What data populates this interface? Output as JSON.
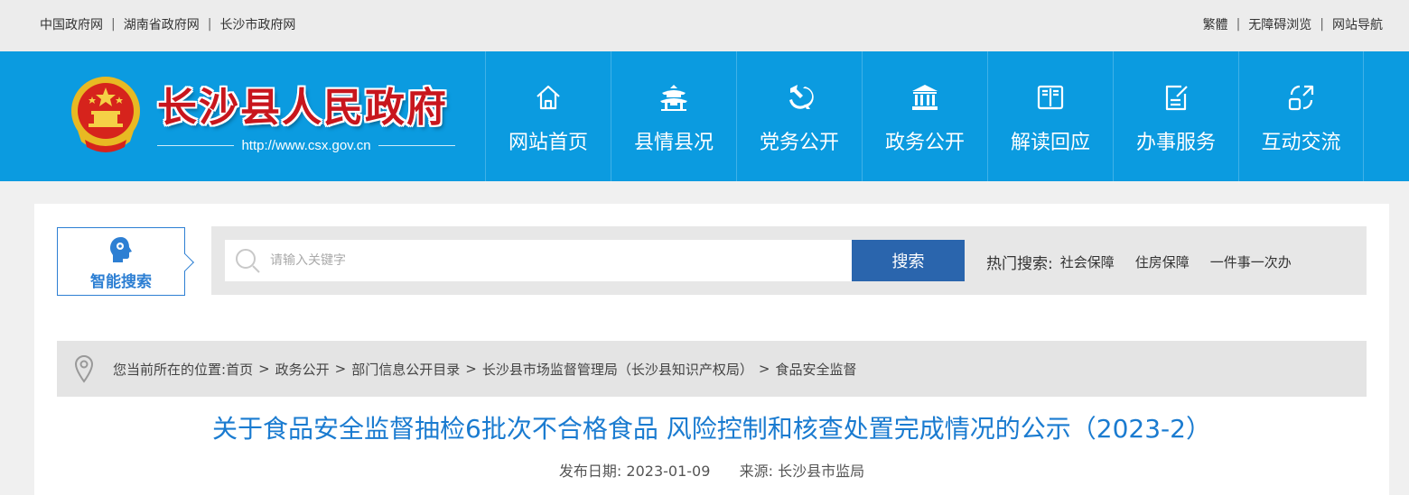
{
  "topbar": {
    "links": [
      "中国政府网",
      "湖南省政府网",
      "长沙市政府网"
    ],
    "right_links": [
      "繁體",
      "无障碍浏览",
      "网站导航"
    ]
  },
  "header": {
    "title": "长沙县人民政府",
    "url": "http://www.csx.gov.cn",
    "nav": [
      {
        "label": "网站首页",
        "icon": "home-icon"
      },
      {
        "label": "县情县况",
        "icon": "pavilion-icon"
      },
      {
        "label": "党务公开",
        "icon": "party-emblem-icon"
      },
      {
        "label": "政务公开",
        "icon": "government-building-icon"
      },
      {
        "label": "解读回应",
        "icon": "open-book-icon"
      },
      {
        "label": "办事服务",
        "icon": "edit-note-icon"
      },
      {
        "label": "互动交流",
        "icon": "exchange-icon"
      }
    ]
  },
  "search": {
    "smart_label": "智能搜索",
    "placeholder": "请输入关键字",
    "button": "搜索",
    "hot_label": "热门搜索:",
    "hot_items": [
      "社会保障",
      "住房保障",
      "一件事一次办"
    ]
  },
  "breadcrumb": {
    "prefix": "您当前所在的位置:",
    "items": [
      "首页",
      "政务公开",
      "部门信息公开目录",
      "长沙县市场监督管理局（长沙县知识产权局）",
      "食品安全监督"
    ]
  },
  "article": {
    "title": "关于食品安全监督抽检6批次不合格食品 风险控制和核查处置完成情况的公示（2023-2）",
    "date_label": "发布日期:",
    "date": "2023-01-09",
    "source_label": "来源:",
    "source": "长沙县市监局"
  },
  "colors": {
    "header_bg": "#0b9be0",
    "title_red": "#c8161d",
    "accent_blue": "#1a7bd0",
    "button_blue": "#2a65ad"
  }
}
